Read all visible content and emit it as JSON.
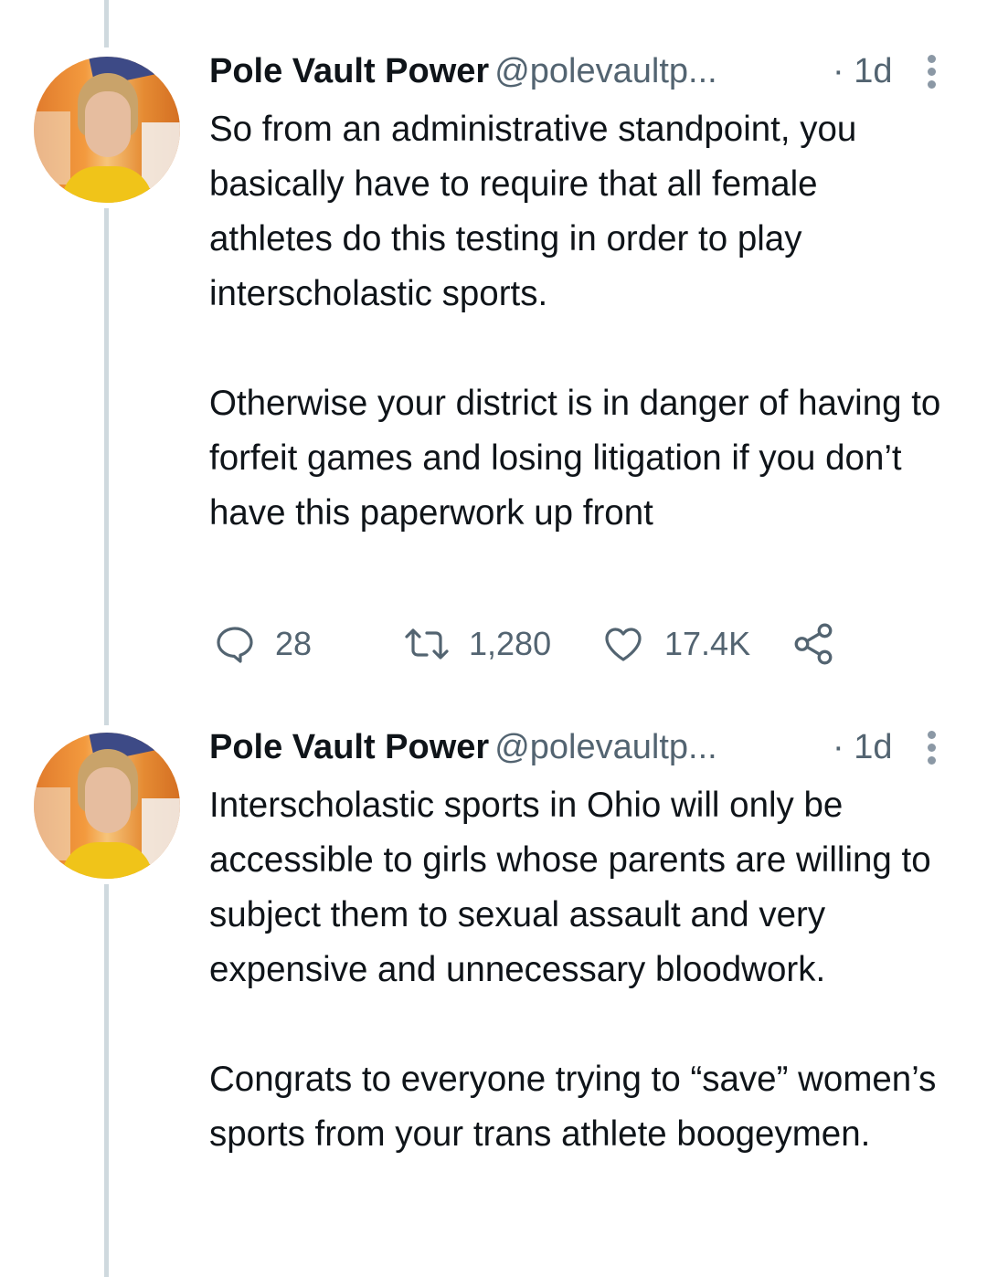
{
  "tweets": [
    {
      "display_name": "Pole Vault Power",
      "handle": "@polevaultp...",
      "time": "· 1d",
      "text": "So from an administrative standpoint, you basically have to require that all female athletes do this testing in order to play interscholastic sports.\n\nOtherwise your district is in danger of having to forfeit games and losing litigation if you don’t have this paperwork up front",
      "reply_count": "28",
      "retweet_count": "1,280",
      "like_count": "17.4K"
    },
    {
      "display_name": "Pole Vault Power",
      "handle": "@polevaultp...",
      "time": "· 1d",
      "text": "Interscholastic sports in Ohio will only be accessible to girls whose parents are willing to subject them to sexual assault and very expensive and unnecessary bloodwork.\n\nCongrats to everyone trying to “save” women’s sports from your trans athlete boogeymen."
    }
  ],
  "icons": [
    "reply-icon",
    "retweet-icon",
    "like-icon",
    "share-icon",
    "more-icon"
  ],
  "colors": {
    "text": "#0f1419",
    "secondary": "#536471",
    "thread_line": "#cfd9de"
  }
}
